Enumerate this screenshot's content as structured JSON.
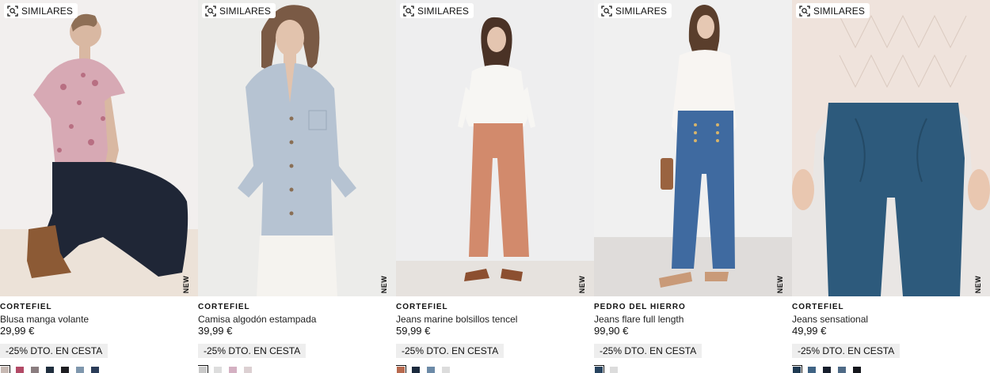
{
  "similar_label": "SIMILARES",
  "new_label": "NEW",
  "products": [
    {
      "brand": "CORTEFIEL",
      "name": "Blusa manga volante",
      "price": "29,99 €",
      "promo": "-25% DTO. EN CESTA",
      "swatches": [
        "#c7b9b3",
        "#b24a66",
        "#8a7d7f",
        "#1f2e3e",
        "#1e1e22",
        "#7f97ad",
        "#2a3c58"
      ],
      "bg": "#f2efee"
    },
    {
      "brand": "CORTEFIEL",
      "name": "Camisa algodón estampada",
      "price": "39,99 €",
      "promo": "-25% DTO. EN CESTA",
      "swatches": [
        "#c9c9c9",
        "#dddddd",
        "#d4b0c2",
        "#dcd0d2"
      ],
      "bg": "#ececea"
    },
    {
      "brand": "CORTEFIEL",
      "name": "Jeans marine bolsillos tencel",
      "price": "59,99 €",
      "promo": "-25% DTO. EN CESTA",
      "swatches": [
        "#b86a4e",
        "#1b2a3d",
        "#6c8aa7",
        "#dcdcdc"
      ],
      "bg": "#eeeeef"
    },
    {
      "brand": "PEDRO DEL HIERRO",
      "name": "Jeans flare full length",
      "price": "99,90 €",
      "promo": "-25% DTO. EN CESTA",
      "swatches": [
        "#27435f",
        "#dcdcdc"
      ],
      "bg": "#f0f0f0"
    },
    {
      "brand": "CORTEFIEL",
      "name": "Jeans sensational",
      "price": "49,99 €",
      "promo": "-25% DTO. EN CESTA",
      "swatches": [
        "#1f3a52",
        "#3f6384",
        "#161e2c",
        "#4e6a86",
        "#14161c"
      ],
      "bg": "#e9e6e4"
    }
  ]
}
